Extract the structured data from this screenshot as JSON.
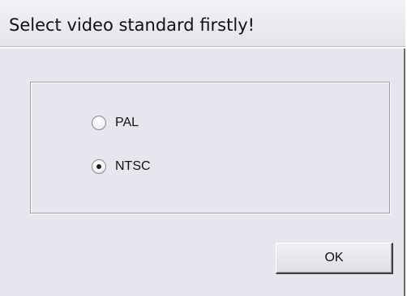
{
  "window": {
    "title": "Select video standard firstly!"
  },
  "video_standard": {
    "options": [
      {
        "label": "PAL",
        "selected": false
      },
      {
        "label": "NTSC",
        "selected": true
      }
    ]
  },
  "actions": {
    "ok_label": "OK"
  }
}
